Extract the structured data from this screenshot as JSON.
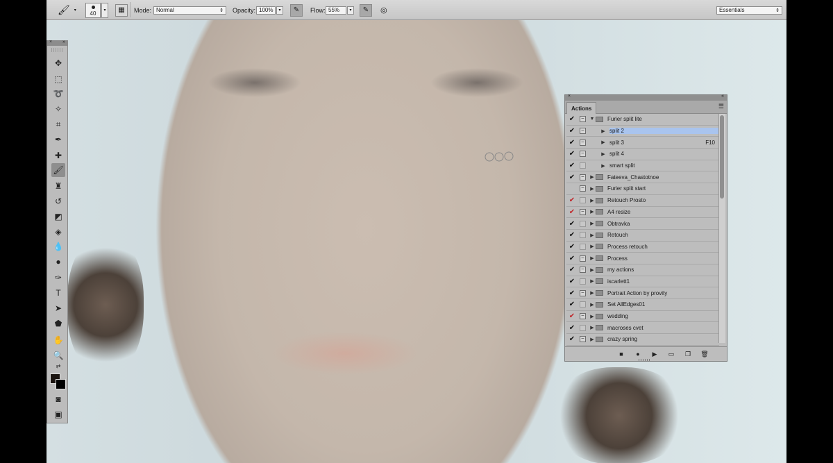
{
  "options_bar": {
    "brush_size": "40",
    "mode_label": "Mode:",
    "mode_value": "Normal",
    "opacity_label": "Opacity:",
    "opacity_value": "100%",
    "flow_label": "Flow:",
    "flow_value": "55%",
    "workspace_value": "Essentials"
  },
  "actions_panel": {
    "tab_label": "Actions",
    "rows": [
      {
        "check": "✔",
        "check_color": "black",
        "dialog": "filled",
        "expanded": true,
        "indent": 0,
        "is_set": true,
        "label": "Furier split lite",
        "key": ""
      },
      {
        "check": "✔",
        "check_color": "black",
        "dialog": "filled",
        "expanded": false,
        "indent": 1,
        "is_set": false,
        "label": "split 2",
        "key": "",
        "selected": true
      },
      {
        "check": "✔",
        "check_color": "black",
        "dialog": "filled",
        "expanded": false,
        "indent": 1,
        "is_set": false,
        "label": "split 3",
        "key": "F10"
      },
      {
        "check": "✔",
        "check_color": "black",
        "dialog": "filled",
        "expanded": false,
        "indent": 1,
        "is_set": false,
        "label": "split 4",
        "key": ""
      },
      {
        "check": "✔",
        "check_color": "black",
        "dialog": "blank",
        "expanded": false,
        "indent": 1,
        "is_set": false,
        "label": "smart split",
        "key": ""
      },
      {
        "check": "✔",
        "check_color": "black",
        "dialog": "filled",
        "expanded": false,
        "indent": 0,
        "is_set": true,
        "label": "Fateeva_Chastotnoe",
        "key": ""
      },
      {
        "check": "",
        "check_color": "black",
        "dialog": "filled",
        "expanded": false,
        "indent": 0,
        "is_set": true,
        "label": "Furier split start",
        "key": ""
      },
      {
        "check": "✔",
        "check_color": "red",
        "dialog": "blank",
        "expanded": false,
        "indent": 0,
        "is_set": true,
        "label": "Retouch Prosto",
        "key": ""
      },
      {
        "check": "✔",
        "check_color": "red",
        "dialog": "filled",
        "expanded": false,
        "indent": 0,
        "is_set": true,
        "label": "A4 resize",
        "key": ""
      },
      {
        "check": "✔",
        "check_color": "black",
        "dialog": "blank",
        "expanded": false,
        "indent": 0,
        "is_set": true,
        "label": "Obtravka",
        "key": ""
      },
      {
        "check": "✔",
        "check_color": "black",
        "dialog": "blank",
        "expanded": false,
        "indent": 0,
        "is_set": true,
        "label": "Retouch",
        "key": ""
      },
      {
        "check": "✔",
        "check_color": "black",
        "dialog": "blank",
        "expanded": false,
        "indent": 0,
        "is_set": true,
        "label": "Process retouch",
        "key": ""
      },
      {
        "check": "✔",
        "check_color": "black",
        "dialog": "filled",
        "expanded": false,
        "indent": 0,
        "is_set": true,
        "label": "Process",
        "key": ""
      },
      {
        "check": "✔",
        "check_color": "black",
        "dialog": "filled",
        "expanded": false,
        "indent": 0,
        "is_set": true,
        "label": "my actions",
        "key": ""
      },
      {
        "check": "✔",
        "check_color": "black",
        "dialog": "blank",
        "expanded": false,
        "indent": 0,
        "is_set": true,
        "label": "iscarlett1",
        "key": ""
      },
      {
        "check": "✔",
        "check_color": "black",
        "dialog": "filled",
        "expanded": false,
        "indent": 0,
        "is_set": true,
        "label": "Portrait Action by provity",
        "key": ""
      },
      {
        "check": "✔",
        "check_color": "black",
        "dialog": "blank",
        "expanded": false,
        "indent": 0,
        "is_set": true,
        "label": "Set AllEdges01",
        "key": ""
      },
      {
        "check": "✔",
        "check_color": "red",
        "dialog": "filled",
        "expanded": false,
        "indent": 0,
        "is_set": true,
        "label": "wedding",
        "key": ""
      },
      {
        "check": "✔",
        "check_color": "black",
        "dialog": "blank",
        "expanded": false,
        "indent": 0,
        "is_set": true,
        "label": "macroses cvet",
        "key": ""
      },
      {
        "check": "✔",
        "check_color": "black",
        "dialog": "filled",
        "expanded": false,
        "indent": 0,
        "is_set": true,
        "label": "crazy spring",
        "key": ""
      }
    ]
  },
  "colors": {
    "selection": "#a9c4ee",
    "red_check": "#c0262a",
    "panel_bg": "#bdbdbd"
  }
}
